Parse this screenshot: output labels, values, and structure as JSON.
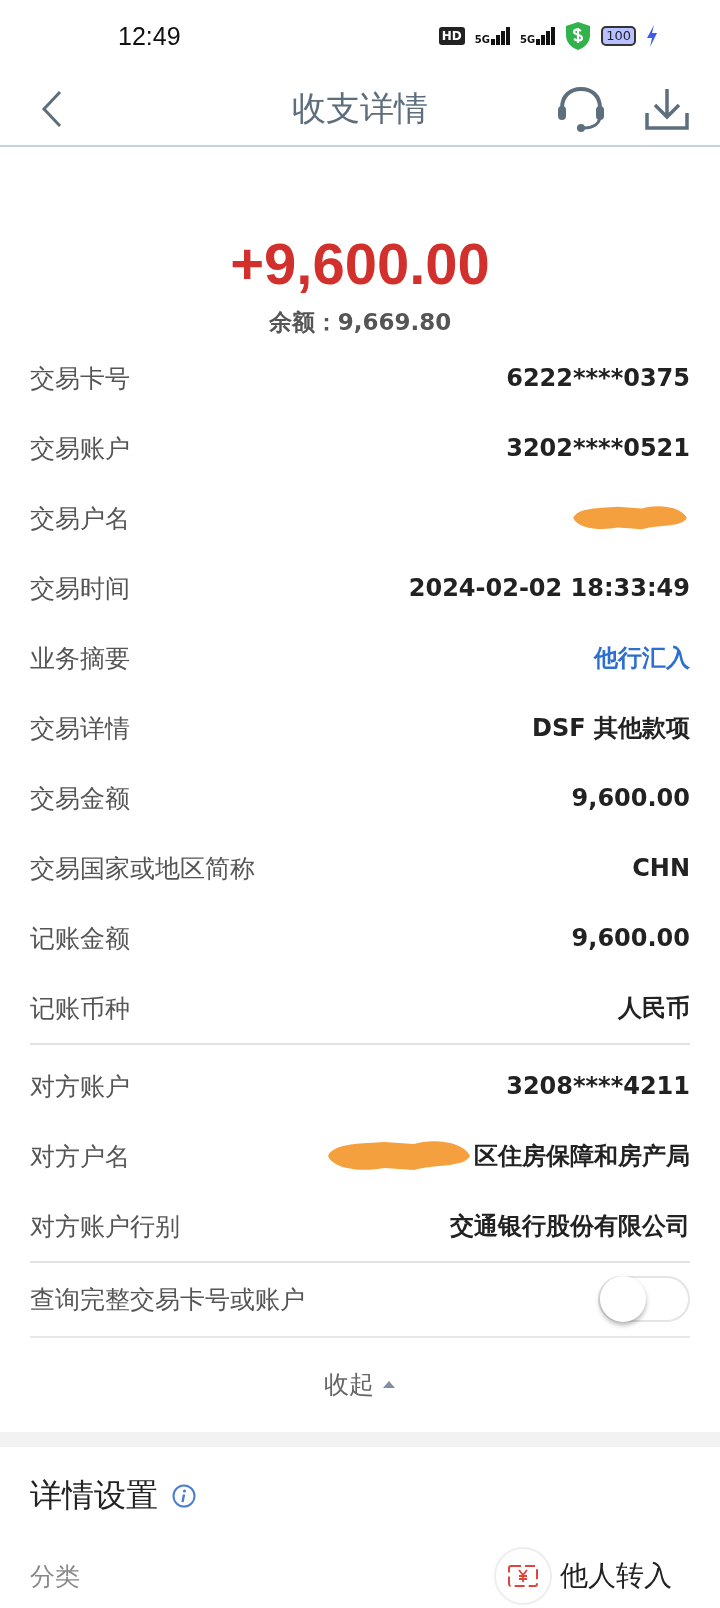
{
  "status_bar": {
    "time": "12:49",
    "hd": "HD",
    "signals": [
      "5G",
      "5G"
    ],
    "battery": "100"
  },
  "nav": {
    "title": "收支详情"
  },
  "amount": {
    "value": "+9,600.00",
    "balance": "余额：9,669.80"
  },
  "groups": [
    [
      {
        "label": "交易卡号",
        "value": "6222****0375",
        "kind": "text",
        "redacted": false
      },
      {
        "label": "交易账户",
        "value": "3202****0521",
        "kind": "text",
        "redacted": false
      },
      {
        "label": "交易户名",
        "redacted": true
      },
      {
        "label": "交易时间",
        "value": "2024-02-02 18:33:49",
        "kind": "text",
        "redacted": false
      },
      {
        "label": "业务摘要",
        "value": "他行汇入",
        "kind": "link",
        "redacted": false
      },
      {
        "label": "交易详情",
        "value": "DSF 其他款项",
        "kind": "text",
        "redacted": false
      },
      {
        "label": "交易金额",
        "value": "9,600.00",
        "kind": "text",
        "redacted": false
      },
      {
        "label": "交易国家或地区简称",
        "value": "CHN",
        "kind": "text",
        "redacted": false
      },
      {
        "label": "记账金额",
        "value": "9,600.00",
        "kind": "text",
        "redacted": false
      },
      {
        "label": "记账币种",
        "value": "人民币",
        "kind": "text",
        "redacted": false
      }
    ],
    [
      {
        "label": "对方账户",
        "value": "3208****4211",
        "kind": "text",
        "redacted": false
      },
      {
        "label": "对方户名",
        "value": "区住房保障和房产局",
        "kind": "text",
        "redacted": true
      },
      {
        "label": "对方账户行别",
        "value": "交通银行股份有限公司",
        "kind": "text",
        "redacted": false
      }
    ]
  ],
  "toggle": {
    "label": "查询完整交易卡号或账户",
    "on": false
  },
  "collapse": {
    "label": "收起"
  },
  "settings": {
    "title": "详情设置",
    "category": {
      "label": "分类",
      "value": "他人转入"
    }
  }
}
